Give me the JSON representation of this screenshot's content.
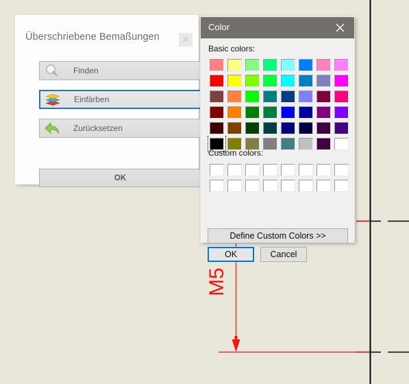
{
  "background": {
    "canvas_color": "#e9e7da",
    "dimension_color": "#ff1111",
    "geometry_color": "#000000"
  },
  "cad": {
    "dimension_text": "M5",
    "dimension_text_rotation_deg": -90,
    "elements": [
      {
        "name": "dimension-extension-line-vertical",
        "color": "#ff1111"
      },
      {
        "name": "dimension-line-horizontal",
        "color": "#ff1111"
      },
      {
        "name": "dimension-arrow-head",
        "color": "#ff1111"
      },
      {
        "name": "part-edge-vertical",
        "color": "#000000"
      },
      {
        "name": "centerline-upper",
        "color": "#000000"
      },
      {
        "name": "centerline-lower",
        "color": "#000000"
      }
    ]
  },
  "tool_dialog": {
    "title": "Überschriebene Bemaßungen",
    "close_glyph": "✕",
    "buttons": [
      {
        "id": "finden",
        "label": "Finden",
        "icon": "magnifier-icon",
        "selected": false
      },
      {
        "id": "einfaerben",
        "label": "Einfärben",
        "icon": "color-layers-icon",
        "selected": true
      },
      {
        "id": "zuruecksetzen",
        "label": "Zurücksetzen",
        "icon": "undo-arrow-icon",
        "selected": false
      }
    ],
    "ok_label": "OK"
  },
  "color_dialog": {
    "title": "Color",
    "close_glyph": "✕",
    "basic_colors_label": "Basic colors:",
    "custom_colors_label": "Custom colors:",
    "selected_index": 40,
    "basic_colors": [
      "#ff8080",
      "#ffff80",
      "#80ff80",
      "#00ff80",
      "#80ffff",
      "#0080ff",
      "#ff80c0",
      "#ff80ff",
      "#ff0000",
      "#ffff00",
      "#80ff00",
      "#00ff40",
      "#00ffff",
      "#0080c0",
      "#8080c0",
      "#ff00ff",
      "#804040",
      "#ff8040",
      "#00ff00",
      "#008080",
      "#004080",
      "#8080ff",
      "#800040",
      "#ff0080",
      "#800000",
      "#ff8000",
      "#008000",
      "#008040",
      "#0000ff",
      "#0000a0",
      "#800080",
      "#8000ff",
      "#400000",
      "#804000",
      "#004000",
      "#004040",
      "#000080",
      "#000040",
      "#400040",
      "#400080",
      "#000000",
      "#808000",
      "#808040",
      "#808080",
      "#408080",
      "#c0c0c0",
      "#400040",
      "#ffffff"
    ],
    "custom_colors": [
      "#ffffff",
      "#ffffff",
      "#ffffff",
      "#ffffff",
      "#ffffff",
      "#ffffff",
      "#ffffff",
      "#ffffff",
      "#ffffff",
      "#ffffff",
      "#ffffff",
      "#ffffff",
      "#ffffff",
      "#ffffff",
      "#ffffff",
      "#ffffff"
    ],
    "define_label": "Define Custom Colors >>",
    "ok_label": "OK",
    "cancel_label": "Cancel"
  }
}
